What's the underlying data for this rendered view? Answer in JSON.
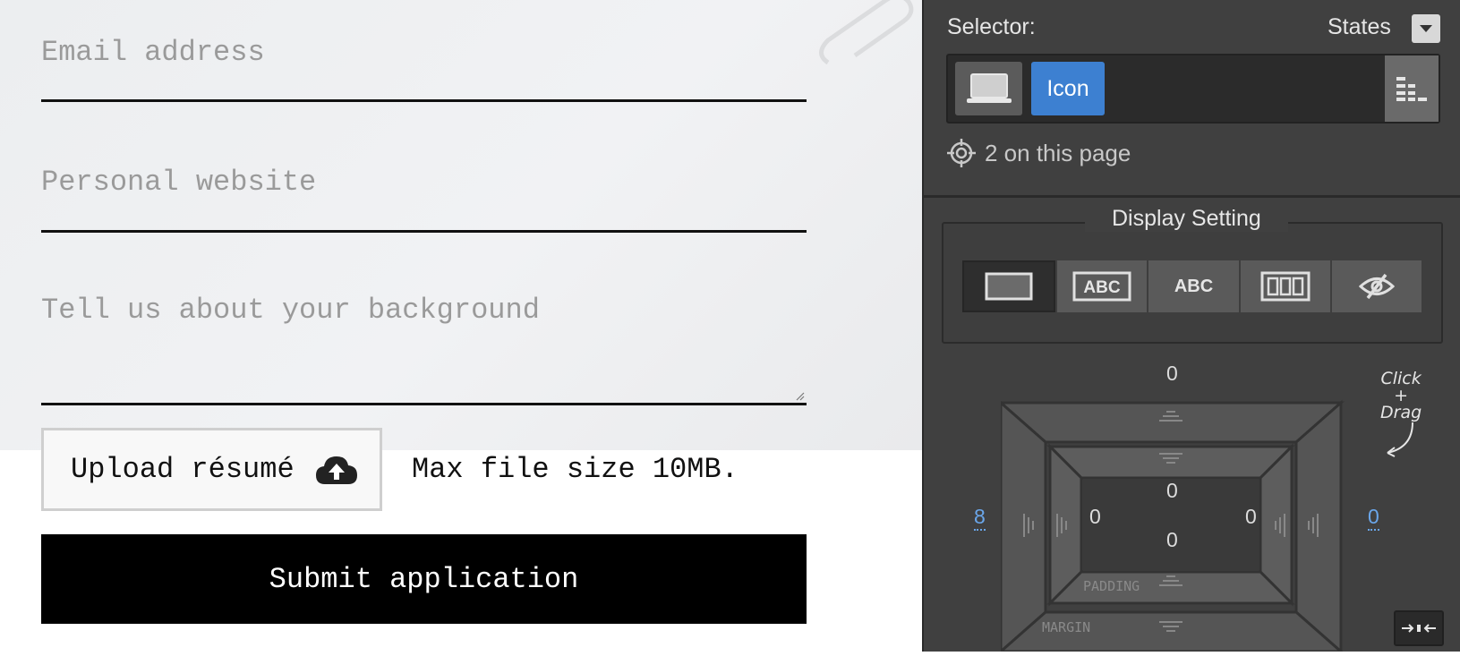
{
  "form": {
    "email_placeholder": "Email address",
    "website_placeholder": "Personal website",
    "background_placeholder": "Tell us about your background",
    "upload_label": "Upload résumé",
    "max_file_text": "Max file size 10MB.",
    "submit_label": "Submit application"
  },
  "panel": {
    "selector_label": "Selector:",
    "states_label": "States",
    "selector_chip": "Icon",
    "count_text": "2 on this page",
    "display_title": "Display Setting",
    "display_options": [
      "block-icon",
      "inline-block-icon",
      "inline-icon",
      "flex-icon",
      "none-icon"
    ],
    "abc_label_1": "ABC",
    "abc_label_2": "ABC",
    "box_model": {
      "margin_top": "0",
      "margin_left": "8",
      "margin_right": "0",
      "padding_top": "0",
      "padding_bottom": "0",
      "padding_left": "0",
      "padding_right": "0",
      "padding_label": "PADDING",
      "margin_label": "MARGIN"
    },
    "hint_line1": "Click",
    "hint_line2": "+",
    "hint_line3": "Drag"
  },
  "colors": {
    "panel_bg": "#404040",
    "accent_blue": "#3d80d1",
    "link_blue": "#6aa6ea",
    "submit_bg": "#000000"
  }
}
